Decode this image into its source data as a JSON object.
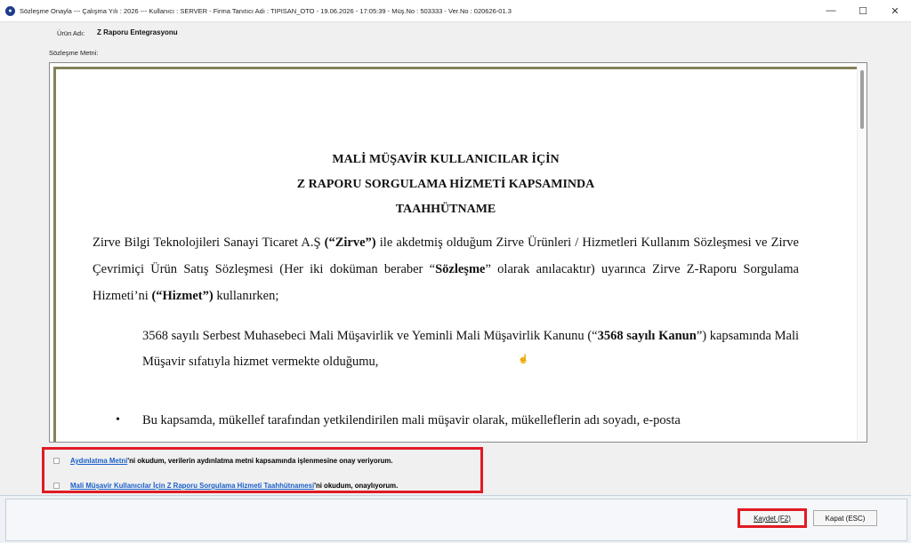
{
  "window": {
    "title": "Sözleşme Onayla  ---  Çalışma Yılı : 2026  ---  Kullanıcı : SERVER - Firma Tanıtıcı Adı : TIPISAN_OTO - 19.06.2026 - 17:05:39 - Müş.No : 503333 - Ver.No : 020626-01.3",
    "minimize_glyph": "—",
    "maximize_glyph": "☐",
    "close_glyph": "✕"
  },
  "form": {
    "product_label": "Ürün Adı:",
    "product_name": "Z Raporu Entegrasyonu",
    "contract_label": "Sözleşme Metni:"
  },
  "document": {
    "title_line1": "MALİ MÜŞAVİR KULLANICILAR İÇİN",
    "title_line2": "Z RAPORU SORGULAMA HİZMETİ KAPSAMINDA",
    "title_line3": "TAAHHÜTNAME",
    "p1_a": "Zirve Bilgi Teknolojileri Sanayi Ticaret A.Ş ",
    "p1_b": "(“Zirve”)",
    "p1_c": " ile akdetmiş olduğum Zirve Ürünleri / Hizmetleri Kullanım Sözleşmesi ve Zirve Çevrimiçi Ürün Satış Sözleşmesi (Her iki doküman beraber “",
    "p1_d": "Sözleşme",
    "p1_e": "” olarak anılacaktır) uyarınca Zirve Z-Raporu Sorgulama Hizmeti’ni ",
    "p1_f": "(“Hizmet”)",
    "p1_g": " kullanırken;",
    "p2_a": "3568 sayılı Serbest Muhasebeci Mali Müşavirlik ve Yeminli Mali Müşavirlik Kanunu (“",
    "p2_b": "3568 sayılı Kanun",
    "p2_c": "”) kapsamında Mali Müşavir sıfatıyla hizmet vermekte olduğumu,",
    "bullet_glyph": "•",
    "bullet1": "Bu kapsamda, mükellef tarafından yetkilendirilen mali müşavir olarak, mükelleflerin adı soyadı, e-posta",
    "cursor_glyph": "☝"
  },
  "consents": {
    "item1_link": "Aydınlatma Metni",
    "item1_rest": "'ni okudum, verilerin aydınlatma metni kapsamında işlenmesine onay veriyorum.",
    "item2_link": "Mali Müşavir Kullanıcılar İçin Z Raporu Sorgulama Hizmeti Taahhütnamesi",
    "item2_rest": "'ni okudum, onaylıyorum."
  },
  "buttons": {
    "save": "Kaydet (F2)",
    "close": "Kapat (ESC)"
  }
}
